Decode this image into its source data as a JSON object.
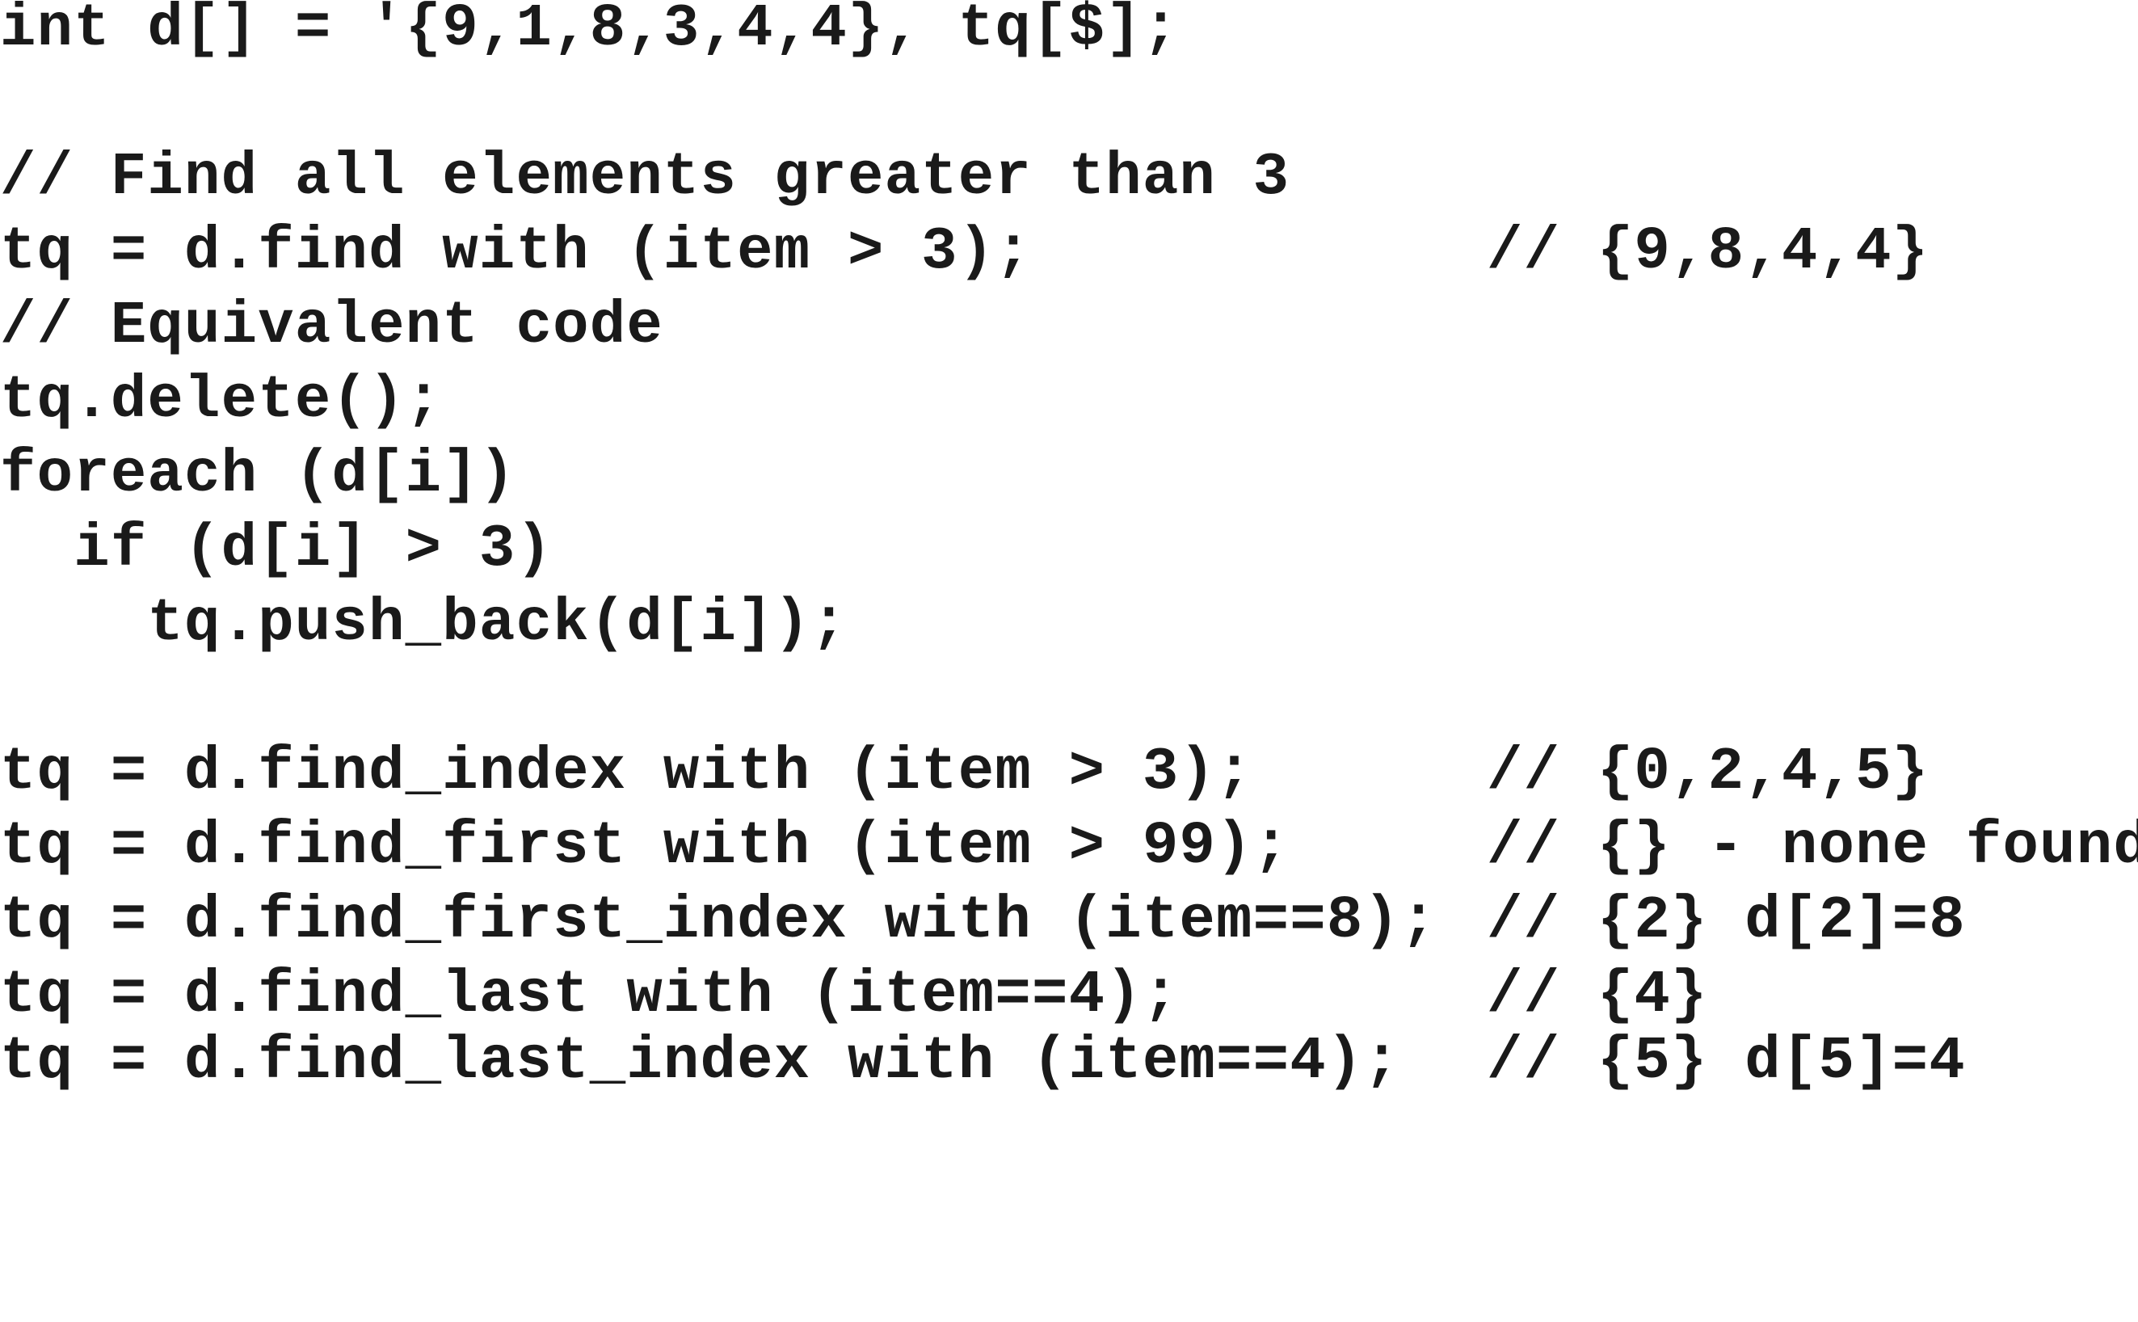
{
  "lines": [
    {
      "code": "int d[] = '{9,1,8,3,4,4}, tq[$];",
      "comment": ""
    },
    {
      "code": "",
      "comment": ""
    },
    {
      "code": "// Find all elements greater than 3",
      "comment": ""
    },
    {
      "code": "tq = d.find with (item > 3);",
      "comment": "// {9,8,4,4}"
    },
    {
      "code": "// Equivalent code",
      "comment": ""
    },
    {
      "code": "tq.delete();",
      "comment": ""
    },
    {
      "code": "foreach (d[i])",
      "comment": ""
    },
    {
      "code": "  if (d[i] > 3)",
      "comment": ""
    },
    {
      "code": "    tq.push_back(d[i]);",
      "comment": ""
    },
    {
      "code": "",
      "comment": ""
    },
    {
      "code": "tq = d.find_index with (item > 3);",
      "comment": "// {0,2,4,5}"
    },
    {
      "code": "tq = d.find_first with (item > 99);",
      "comment": "// {} - none found"
    },
    {
      "code": "tq = d.find_first_index with (item==8);",
      "comment": "// {2} d[2]=8"
    },
    {
      "code": "tq = d.find_last with (item==4);",
      "comment": "// {4}"
    },
    {
      "code": "tq = d.find_last_index with (item==4);",
      "comment": "// {5} d[5]=4"
    }
  ]
}
